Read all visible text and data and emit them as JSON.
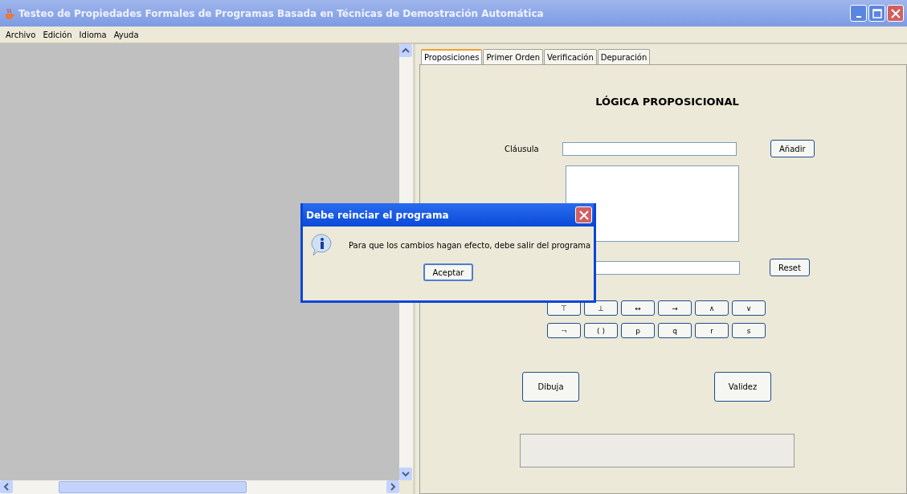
{
  "window": {
    "title": "Testeo de Propiedades Formales de Programas Basada en Técnicas de Demostración Automática"
  },
  "menu": [
    "Archivo",
    "Edición",
    "Idioma",
    "Ayuda"
  ],
  "tabs": [
    {
      "label": "Proposiciones",
      "selected": true
    },
    {
      "label": "Primer Orden",
      "selected": false
    },
    {
      "label": "Verificación",
      "selected": false
    },
    {
      "label": "Depuración",
      "selected": false
    }
  ],
  "panel": {
    "heading": "LÓGICA PROPOSICIONAL",
    "clause_label": "Cláusula",
    "add_button": "Añadir",
    "reset_button": "Reset",
    "symbols": [
      [
        "⊤",
        "⊥",
        "↔",
        "→",
        "∧",
        "∨"
      ],
      [
        "¬",
        "( )",
        "p",
        "q",
        "r",
        "s"
      ]
    ],
    "draw_button": "Dibuja",
    "validity_button": "Validez"
  },
  "dialog": {
    "title": "Debe reinciar el programa",
    "message": "Para que los cambios hagan efecto, debe salir del programa",
    "button": "Aceptar"
  }
}
